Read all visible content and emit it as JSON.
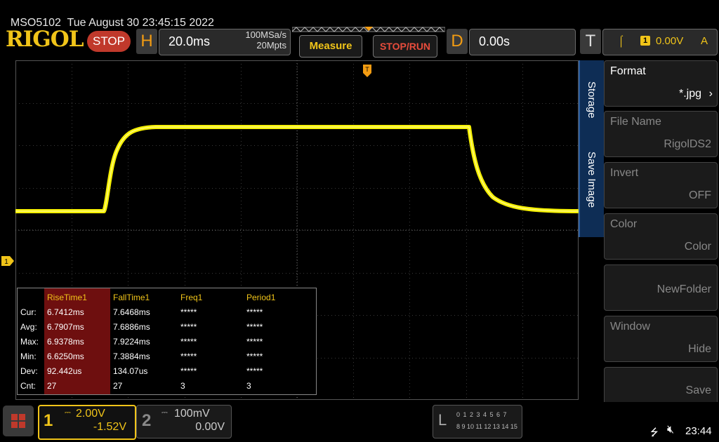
{
  "header": {
    "model": "MSO5102",
    "datetime": "Tue August 30 23:45:15 2022",
    "logo": "RIGOL",
    "run_state": "STOP"
  },
  "horizontal": {
    "letter": "H",
    "timebase": "20.0ms",
    "sample_rate": "100MSa/s",
    "memory_depth": "20Mpts"
  },
  "toolbar": {
    "measure_label": "Measure",
    "stoprun_label": "STOP/RUN"
  },
  "delay": {
    "letter": "D",
    "value": "0.00s"
  },
  "trigger": {
    "letter": "T",
    "edge_icon": "rising-edge-icon",
    "source": "1",
    "level": "0.00V",
    "mode": "A"
  },
  "channel_marker": "1",
  "measurements": {
    "headers": [
      "RiseTime1",
      "FallTime1",
      "Freq1",
      "Period1"
    ],
    "rows": [
      {
        "label": "Cur:",
        "values": [
          "6.7412ms",
          "7.6468ms",
          "*****",
          "*****"
        ]
      },
      {
        "label": "Avg:",
        "values": [
          "6.7907ms",
          "7.6886ms",
          "*****",
          "*****"
        ]
      },
      {
        "label": "Max:",
        "values": [
          "6.9378ms",
          "7.9224ms",
          "*****",
          "*****"
        ]
      },
      {
        "label": "Min:",
        "values": [
          "6.6250ms",
          "7.3884ms",
          "*****",
          "*****"
        ]
      },
      {
        "label": "Dev:",
        "values": [
          "92.442us",
          "134.07us",
          "*****",
          "*****"
        ]
      },
      {
        "label": "Cnt:",
        "values": [
          "27",
          "27",
          "3",
          "3"
        ]
      }
    ]
  },
  "menu": {
    "tab_labels": [
      "Storage",
      "Save Image"
    ],
    "items": [
      {
        "title": "Format",
        "value": "*.jpg",
        "enabled": true
      },
      {
        "title": "File Name",
        "value": "RigolDS2",
        "enabled": false
      },
      {
        "title": "Invert",
        "value": "OFF",
        "enabled": false
      },
      {
        "title": "Color",
        "value": "Color",
        "enabled": false
      },
      {
        "title": "",
        "value": "NewFolder",
        "enabled": false
      },
      {
        "title": "Window",
        "value": "Hide",
        "enabled": false
      },
      {
        "title": "",
        "value": "Save",
        "enabled": false
      }
    ]
  },
  "channels": [
    {
      "number": "1",
      "scale": "2.00V",
      "offset": "-1.52V",
      "coupling_icon": "dc-coupling-icon",
      "active": true
    },
    {
      "number": "2",
      "scale": "100mV",
      "offset": "0.00V",
      "coupling_icon": "dc-coupling-icon",
      "active": false
    }
  ],
  "logic_analyzer": {
    "letter": "L",
    "row1": "0 1 2 3  4 5 6 7",
    "row2": "8 9 10 11 12 13 14 15"
  },
  "status": {
    "time": "23:44",
    "usb_icon": "usb-icon",
    "sound_icon": "speaker-muted-icon"
  },
  "colors": {
    "trace": "#f5f000",
    "accent": "#f0c419",
    "stop": "#c0392b",
    "menu_tab": "#0e2d55"
  }
}
